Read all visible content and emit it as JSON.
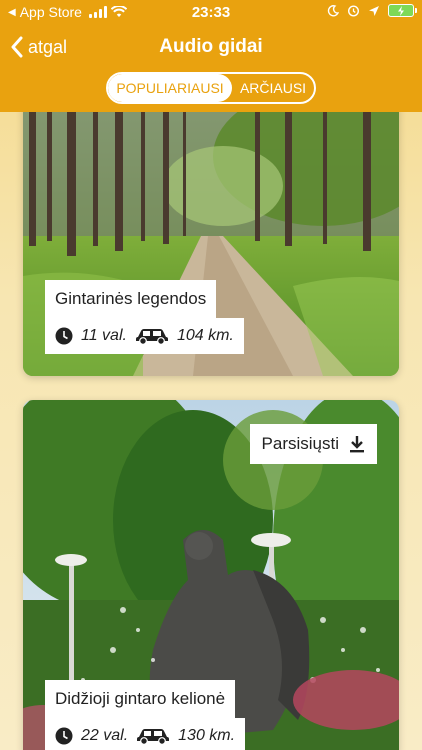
{
  "status_bar": {
    "back_app": "App Store",
    "time": "23:33"
  },
  "nav": {
    "back_label": "atgal",
    "title": "Audio gidai"
  },
  "tabs": [
    {
      "label": "POPULIARIAUSI",
      "active": true
    },
    {
      "label": "ARČIAUSI",
      "active": false
    }
  ],
  "colors": {
    "accent": "#e9a20f",
    "background": "#f7e6b2"
  },
  "guides": [
    {
      "title": "Gintarinės legendos",
      "duration": "11 val.",
      "distance": "104 km.",
      "image": "forest-path"
    },
    {
      "title": "Didžioji gintaro kelionė",
      "duration": "22 val.",
      "distance": "130 km.",
      "download_label": "Parsisiųsti",
      "image": "sculpture-fountain"
    }
  ]
}
